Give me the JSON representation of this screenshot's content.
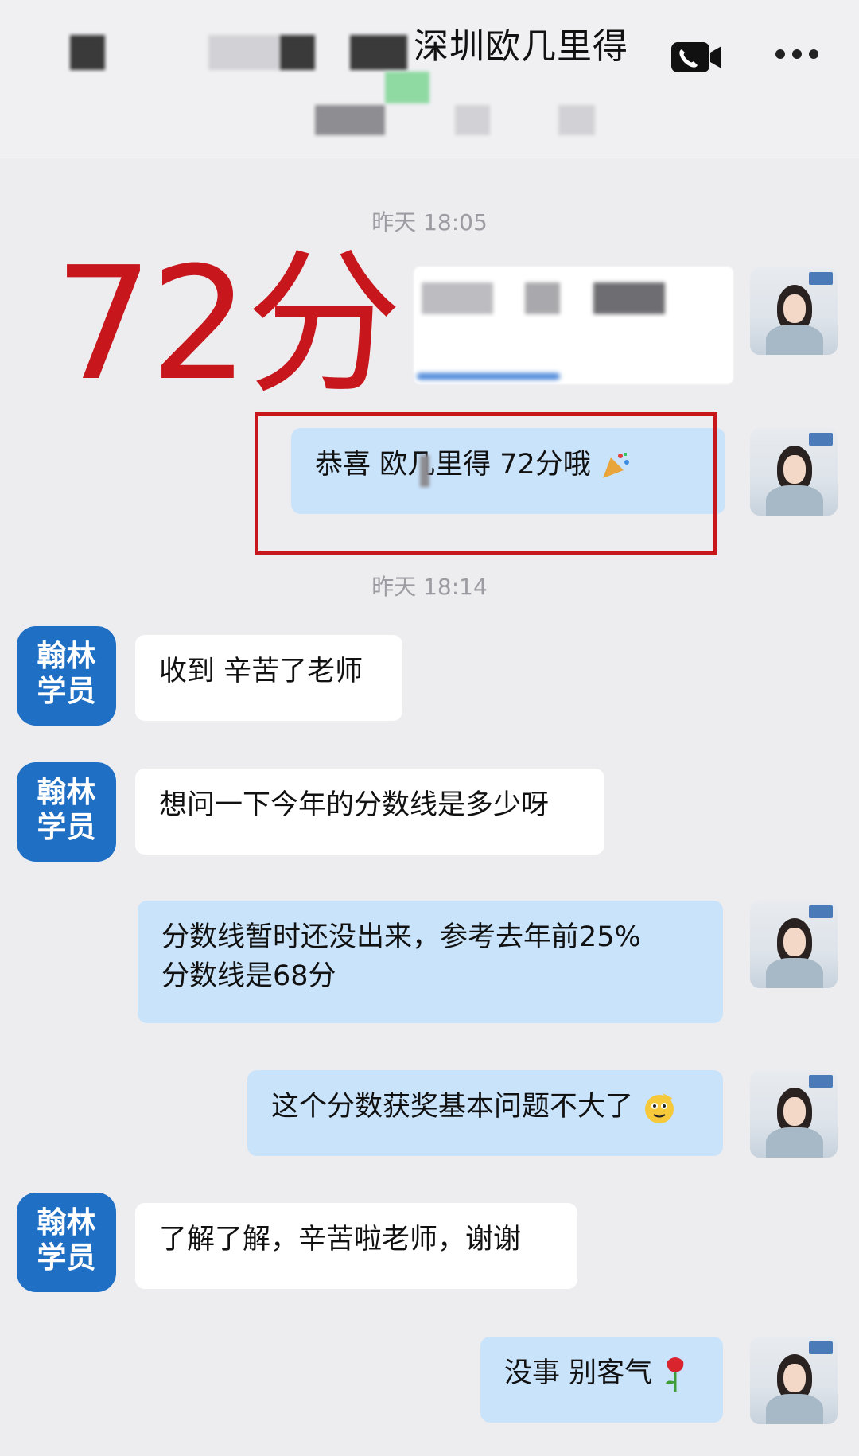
{
  "header": {
    "title": "深圳欧几里得",
    "video_icon": "video-call-icon",
    "more_icon": "more-icon"
  },
  "timestamps": [
    "昨天 18:05",
    "昨天 18:14"
  ],
  "score_overlay": "72分",
  "messages": [
    {
      "side": "out",
      "text": "恭喜  欧几里得 72分哦",
      "emoji": "party-popper-icon"
    },
    {
      "side": "in",
      "sender": "翰林学员",
      "text": "收到 辛苦了老师"
    },
    {
      "side": "in",
      "sender": "翰林学员",
      "text": "想问一下今年的分数线是多少呀"
    },
    {
      "side": "out",
      "text": "分数线暂时还没出来，参考去年前25%",
      "text2": "分数线是68分"
    },
    {
      "side": "out",
      "text": "这个分数获奖基本问题不大了",
      "emoji": "salute-face-icon"
    },
    {
      "side": "in",
      "sender": "翰林学员",
      "text": "了解了解，辛苦啦老师，谢谢"
    },
    {
      "side": "out",
      "text": "没事 别客气",
      "emoji": "rose-icon"
    }
  ],
  "student_label": [
    "翰林",
    "学员"
  ],
  "colors": {
    "accent_red": "#c8161d",
    "student_blue": "#1f6fc4",
    "out_bubble": "#c9e3fb",
    "in_bubble": "#ffffff"
  }
}
